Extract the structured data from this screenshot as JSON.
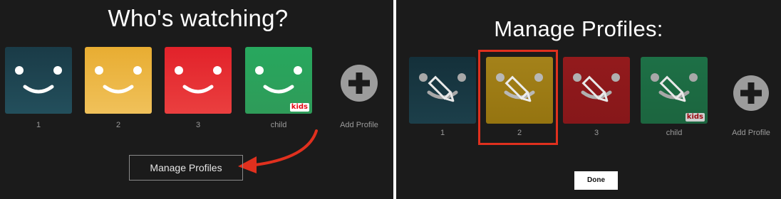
{
  "who_screen": {
    "title": "Who's watching?",
    "profiles": [
      {
        "label": "1",
        "color": "#1c3f4b"
      },
      {
        "label": "2",
        "color": "#e9b23a"
      },
      {
        "label": "3",
        "color": "#e5262a"
      },
      {
        "label": "child",
        "color": "#2aa35e",
        "badge": "kids"
      }
    ],
    "add_profile_label": "Add Profile",
    "manage_button": "Manage Profiles"
  },
  "manage_screen": {
    "title": "Manage Profiles:",
    "profiles": [
      {
        "label": "1",
        "color": "#16323c"
      },
      {
        "label": "2",
        "color": "#9c7c13"
      },
      {
        "label": "3",
        "color": "#8e1a1c"
      },
      {
        "label": "child",
        "color": "#1f6d44",
        "badge": "kids"
      }
    ],
    "selected_profile": "2",
    "add_profile_label": "Add Profile",
    "done_button": "Done"
  },
  "colors": {
    "background": "#1b1b1b",
    "highlight": "#e0301e",
    "arrow": "#e0301e"
  }
}
